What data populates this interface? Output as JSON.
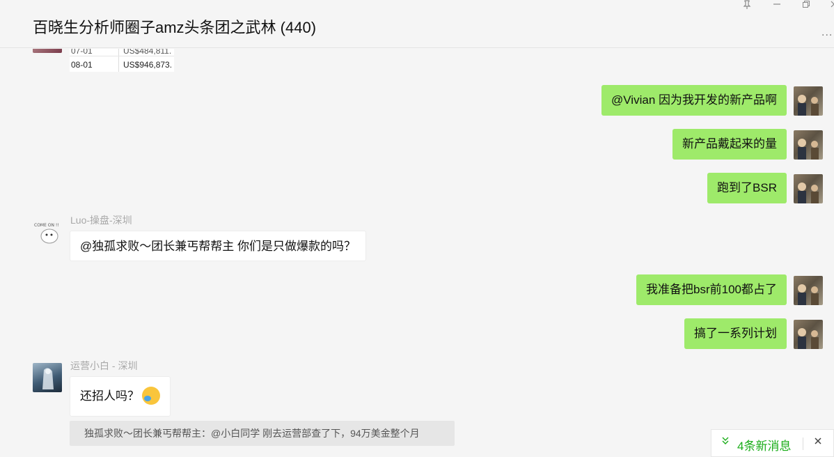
{
  "window": {
    "title": "百晓生分析师圈子amz头条团之武林 (440)",
    "controls": {
      "pin": "pin-icon",
      "minimize": "minimize-icon",
      "restore": "restore-icon",
      "close": "close-icon"
    },
    "more_label": "..."
  },
  "image_preview": {
    "rows": [
      {
        "date": "07-01",
        "value": "US$484,811."
      },
      {
        "date": "08-01",
        "value": "US$946,873."
      }
    ]
  },
  "messages": [
    {
      "side": "right",
      "text": "@Vivian 因为我开发的新产品啊"
    },
    {
      "side": "right",
      "text": "新产品戴起来的量"
    },
    {
      "side": "right",
      "text": "跑到了BSR"
    },
    {
      "side": "left",
      "sender": "Luo-操盘-深圳",
      "text": "@独孤求败～团长兼丐帮帮主 你们是只做爆款的吗？"
    },
    {
      "side": "right",
      "text": "我准备把bsr前100都占了"
    },
    {
      "side": "right",
      "text": "搞了一系列计划"
    },
    {
      "side": "left",
      "sender": "运营小白 - 深圳",
      "text": "还招人吗？"
    }
  ],
  "quote": "独孤求败～团长兼丐帮帮主：@小白同学 刚去运营部查了下，94万美金整个月",
  "new_messages": {
    "label": "4条新消息"
  },
  "colors": {
    "green_bubble": "#9eea6a",
    "accent": "#1aad19",
    "background": "#f5f5f5"
  }
}
